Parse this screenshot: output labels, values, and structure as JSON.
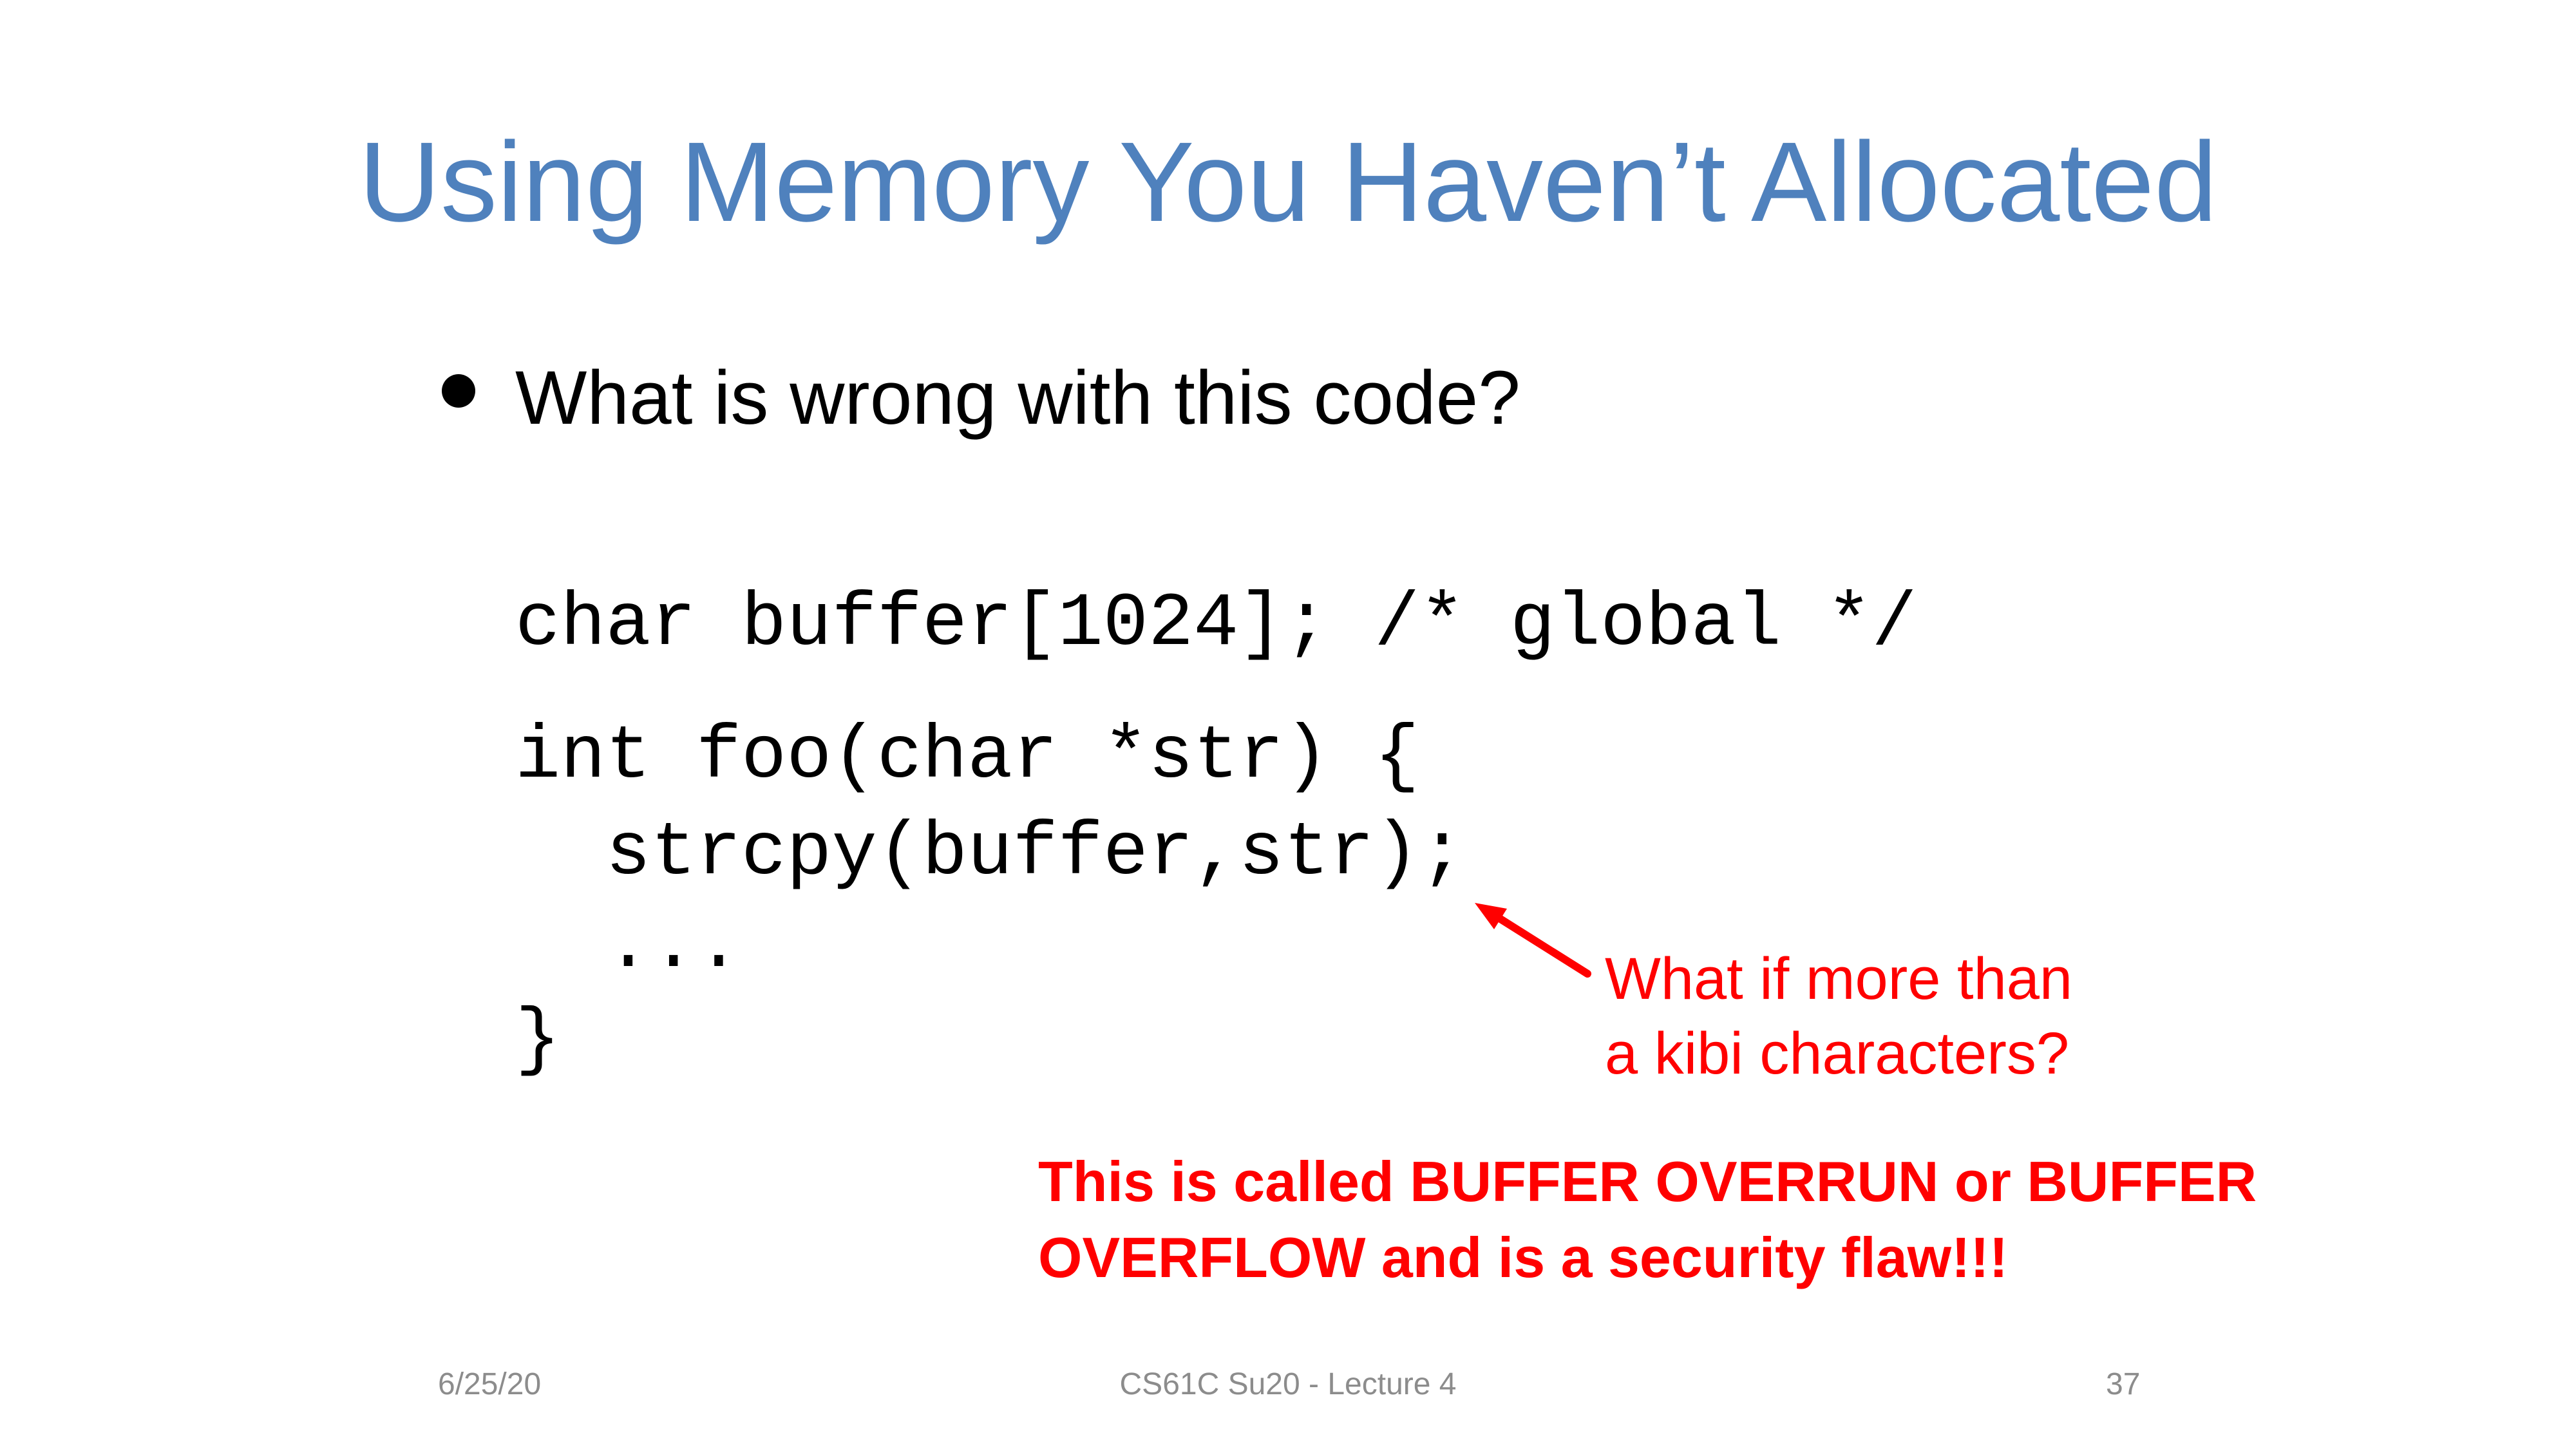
{
  "slide": {
    "title": "Using Memory You Haven’t Allocated",
    "bullet": "What is wrong with this code?",
    "code_lines": [
      "char buffer[1024]; /* global */",
      "int foo(char *str) {",
      "  strcpy(buffer,str);",
      "  ...",
      "}"
    ],
    "annotation_lines": [
      "What if more than",
      "a kibi characters?"
    ],
    "warning_lines": [
      "This is called BUFFER OVERRUN or BUFFER",
      "OVERFLOW and is a security flaw!!!"
    ],
    "footer": {
      "date": "6/25/20",
      "course": "CS61C Su20 - Lecture 4",
      "page": "37"
    }
  },
  "colors": {
    "title": "#4f81bd",
    "annotation": "#ff0000",
    "footer": "#8c8c8c"
  },
  "icons": {
    "bullet": "bullet-dot-icon",
    "arrow": "red-arrow-icon"
  }
}
